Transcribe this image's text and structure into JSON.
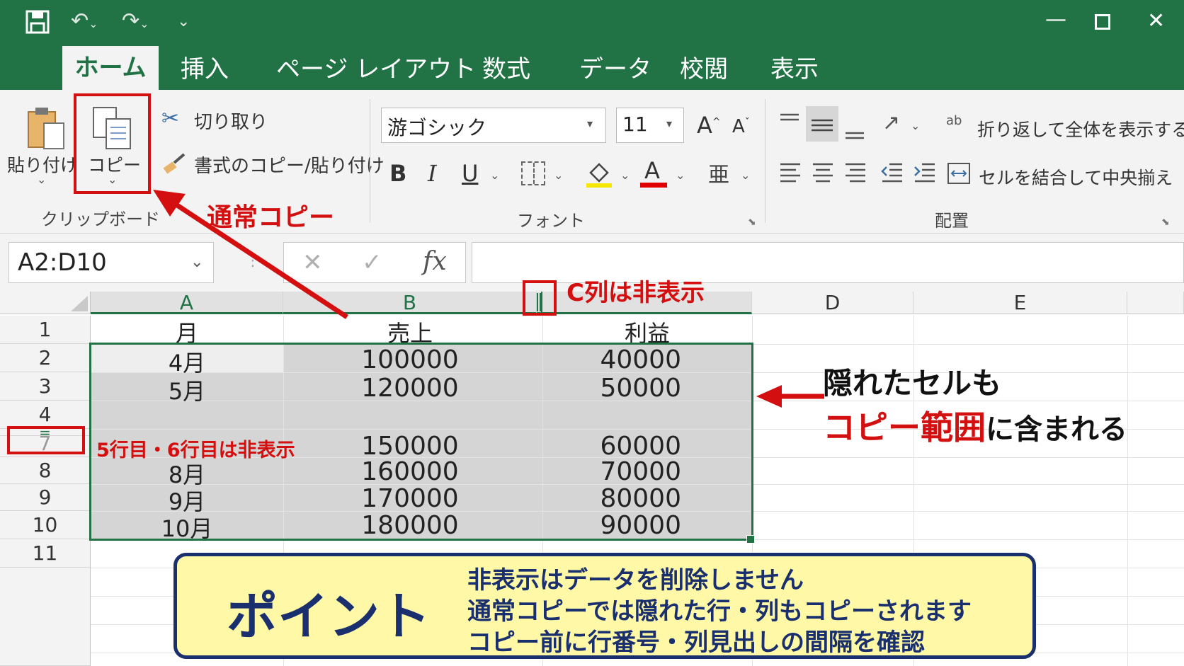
{
  "titlebar": {
    "tabs": [
      "ホーム",
      "挿入",
      "ページ レイアウト",
      "数式",
      "データ",
      "校閲",
      "表示"
    ],
    "window_controls": [
      "minimize-icon",
      "maximize-icon",
      "close-icon"
    ]
  },
  "ribbon": {
    "clipboard": {
      "paste_label": "貼り付け",
      "copy_label": "コピー",
      "cut_label": "切り取り",
      "format_painter_label": "書式のコピー/貼り付け",
      "group_label": "クリップボード"
    },
    "font": {
      "font_name": "游ゴシック",
      "font_size": "11",
      "group_label": "フォント",
      "bold": "B",
      "italic": "I",
      "underline": "U",
      "grow": "A",
      "shrink": "A",
      "font_color_glyph": "A",
      "phonetic_glyph": "亜"
    },
    "alignment": {
      "wrap_label": "折り返して全体を表示する",
      "merge_label": "セルを結合して中央揃え",
      "group_label": "配置",
      "ab_glyph": "ab"
    }
  },
  "formula_bar": {
    "name_box": "A2:D10",
    "fx": "fx",
    "formula_value": ""
  },
  "sheet": {
    "columns": [
      "A",
      "B",
      "D",
      "E"
    ],
    "rows": [
      {
        "num": "1",
        "a": "月",
        "b": "売上",
        "d": "利益"
      },
      {
        "num": "2",
        "a": "4月",
        "b": "100000",
        "d": "40000"
      },
      {
        "num": "3",
        "a": "5月",
        "b": "120000",
        "d": "50000"
      },
      {
        "num": "4",
        "a": "",
        "b": "",
        "d": ""
      },
      {
        "num": "7",
        "a": "",
        "b": "150000",
        "d": "60000"
      },
      {
        "num": "8",
        "a": "8月",
        "b": "160000",
        "d": "70000"
      },
      {
        "num": "9",
        "a": "9月",
        "b": "170000",
        "d": "80000"
      },
      {
        "num": "10",
        "a": "10月",
        "b": "180000",
        "d": "90000"
      },
      {
        "num": "11",
        "a": "",
        "b": "",
        "d": ""
      }
    ],
    "hidden_row_marker": "="
  },
  "annotations": {
    "copy_callout": "通常コピー",
    "hidden_col_callout": "C列は非表示",
    "hidden_rows_callout": "5行目・6行目は非表示",
    "hidden_cells_line1": "隠れたセルも",
    "hidden_cells_line2_red": "コピー範囲",
    "hidden_cells_line2_rest": "に含まれる"
  },
  "point": {
    "title": "ポイント",
    "lines": [
      "非表示はデータを削除しません",
      "通常コピーでは隠れた行・列もコピーされます",
      "コピー前に行番号・列見出しの間隔を確認"
    ]
  },
  "colors": {
    "excel_green": "#217346",
    "annotation_red": "#d40f0f",
    "point_bg": "#fff8a6",
    "point_border": "#1a2f6e",
    "selection_gray": "#d5d5d5"
  }
}
